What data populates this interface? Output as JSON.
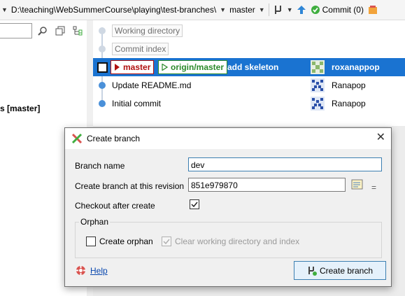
{
  "toolbar": {
    "repo_path": "D:\\teaching\\WebSummerCourse\\playing\\test-branches\\",
    "branch": "master",
    "commit_button": "Commit (0)"
  },
  "left_pane": {
    "branch_label": "s [master]"
  },
  "graph": {
    "rows": [
      {
        "label": "Working directory"
      },
      {
        "label": "Commit index"
      },
      {
        "tag_local": "master",
        "tag_remote": "origin/master",
        "message": "add skeleton",
        "author": "roxanappop"
      },
      {
        "message": "Update README.md",
        "author": "Ranapop"
      },
      {
        "message": "Initial commit",
        "author": "Ranapop"
      }
    ]
  },
  "dialog": {
    "title": "Create branch",
    "branch_name_label": "Branch name",
    "branch_name_value": "dev",
    "revision_label": "Create branch at this revision",
    "revision_value": "851e979870",
    "equals": "=",
    "checkout_label": "Checkout after create",
    "checkout_checked": true,
    "orphan_group": "Orphan",
    "create_orphan_label": "Create orphan",
    "clear_wd_label": "Clear working directory and index",
    "help_label": "Help",
    "create_button": "Create branch"
  },
  "colors": {
    "selection": "#1a73d1",
    "local_branch": "#b11010",
    "remote_branch": "#2b8a2b",
    "link": "#0645ad"
  }
}
